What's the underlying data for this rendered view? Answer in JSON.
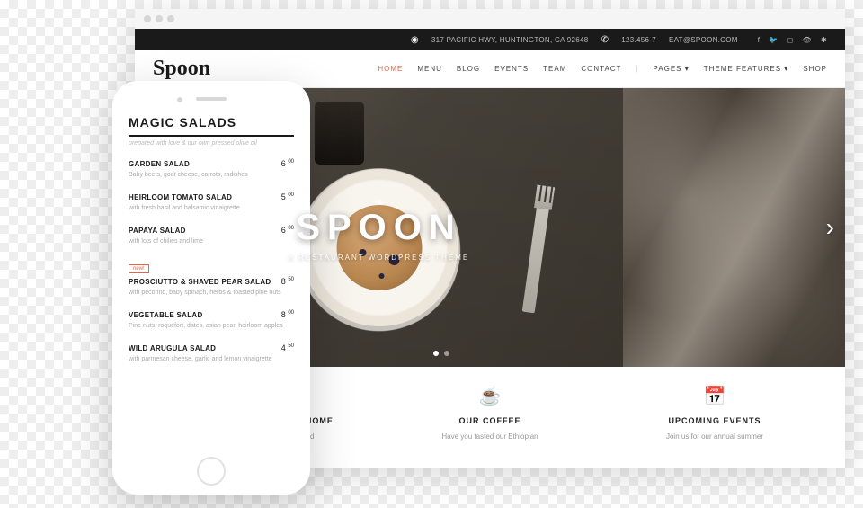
{
  "topbar": {
    "address": "317 PACIFIC HWY, HUNTINGTON, CA 92648",
    "phone": "123.456-7",
    "email": "EAT@SPOON.COM"
  },
  "logo": "Spoon",
  "nav": {
    "home": "HOME",
    "menu": "MENU",
    "blog": "BLOG",
    "events": "EVENTS",
    "team": "TEAM",
    "contact": "CONTACT",
    "pages": "PAGES",
    "theme": "THEME FEATURES",
    "shop": "SHOP",
    "sep": "|"
  },
  "hero": {
    "title": "SPOON",
    "subtitle": "A RESTAURANT WORDPRESS THEME"
  },
  "features": [
    {
      "title": "WE DELIVER TO YOUR HOME",
      "desc": "Order healthy food on-demand",
      "icon": "bike-icon"
    },
    {
      "title": "OUR COFFEE",
      "desc": "Have you tasted our Ethiopian",
      "icon": "cup-icon"
    },
    {
      "title": "UPCOMING EVENTS",
      "desc": "Join us for our annual summer",
      "icon": "calendar-icon"
    }
  ],
  "mobile": {
    "heading": "MAGIC SALADS",
    "tagline": "prepared with love & our own pressed olive oil",
    "items": [
      {
        "name": "GARDEN SALAD",
        "price": "6",
        "cents": "00",
        "desc": "Baby beets, goat cheese, carrots, radishes"
      },
      {
        "name": "HEIRLOOM TOMATO SALAD",
        "price": "5",
        "cents": "00",
        "desc": "with fresh basil and balsamic vinaigrette"
      },
      {
        "name": "PAPAYA SALAD",
        "price": "6",
        "cents": "00",
        "desc": "with lots of chilies and lime"
      },
      {
        "name": "PROSCIUTTO & SHAVED PEAR SALAD",
        "price": "8",
        "cents": "50",
        "desc": "with pecorino, baby spinach, herbs & toasted pine nuts",
        "badge": "new!"
      },
      {
        "name": "VEGETABLE SALAD",
        "price": "8",
        "cents": "00",
        "desc": "Pine nuts, roquefort, dates, asian pear, heirloom apples"
      },
      {
        "name": "WILD ARUGULA SALAD",
        "price": "4",
        "cents": "50",
        "desc": "with parmesan cheese, garlic and lemon vinaigrette"
      }
    ]
  }
}
